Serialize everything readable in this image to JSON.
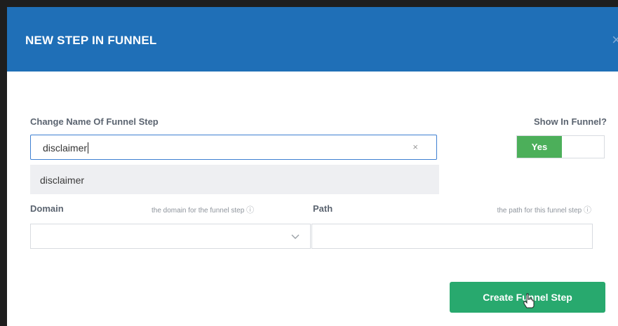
{
  "modal": {
    "title": "NEW STEP IN FUNNEL",
    "close_icon": "×"
  },
  "form": {
    "name_label": "Change Name Of Funnel Step",
    "name_value": "disclaimer",
    "clear_icon": "×",
    "suggestion": "disclaimer",
    "show_label": "Show In Funnel?",
    "toggle_label": "Yes",
    "domain_label": "Domain",
    "domain_help": "the domain for the funnel step",
    "path_label": "Path",
    "path_help": "the path for this funnel step",
    "help_icon": "?",
    "chevron_icon": "﹀"
  },
  "actions": {
    "create_label": "Create Funnel Step"
  },
  "colors": {
    "header": "#1f6fb7",
    "toggle_on": "#4caf5a",
    "button": "#28a96e"
  }
}
